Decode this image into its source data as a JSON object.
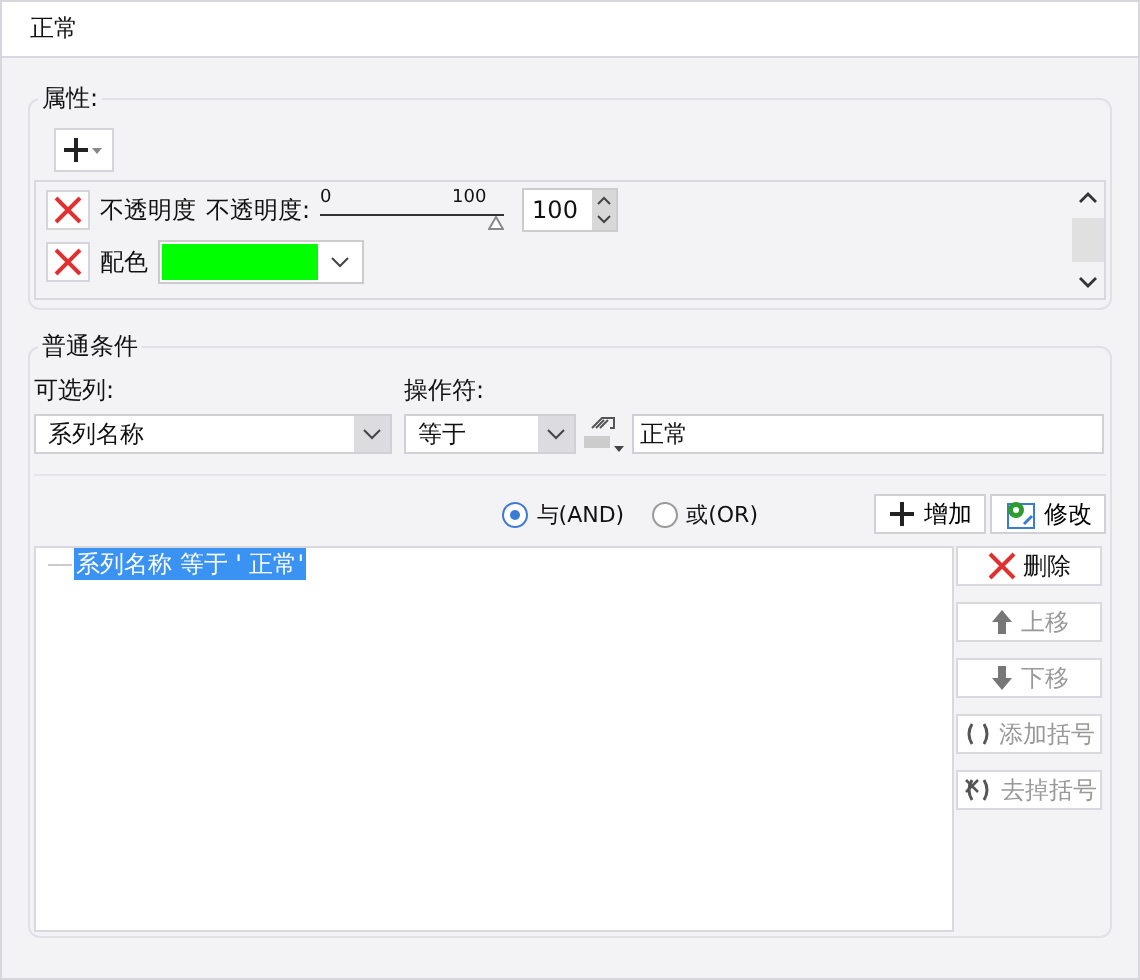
{
  "title": "正常",
  "properties": {
    "label": "属性:",
    "rows": [
      {
        "kind": "slider",
        "name": "不透明度",
        "slider_label": "不透明度:",
        "min_label": "0",
        "max_label": "100",
        "level": 1,
        "value": "100"
      },
      {
        "kind": "color",
        "name": "配色",
        "color": "#00ff00"
      }
    ]
  },
  "condition": {
    "label": "普通条件",
    "column_label": "可选列:",
    "column_value": "系列名称",
    "operator_label": "操作符:",
    "operator_value": "等于",
    "value": "正常",
    "logic": [
      {
        "label": "与(AND)",
        "selected": true
      },
      {
        "label": "或(OR)",
        "selected": false
      }
    ],
    "add_button": "增加",
    "modify_button": "修改",
    "tree": [
      {
        "label": "系列名称 等于 ' 正常'",
        "selected": true
      }
    ],
    "actions": [
      {
        "kind": "delete",
        "label": "删除",
        "disabled": false
      },
      {
        "kind": "up",
        "label": "上移",
        "disabled": true
      },
      {
        "kind": "down",
        "label": "下移",
        "disabled": true
      },
      {
        "kind": "add-paren",
        "label": "添加括号",
        "disabled": true
      },
      {
        "kind": "remove-paren",
        "label": "去掉括号",
        "disabled": true
      }
    ]
  }
}
